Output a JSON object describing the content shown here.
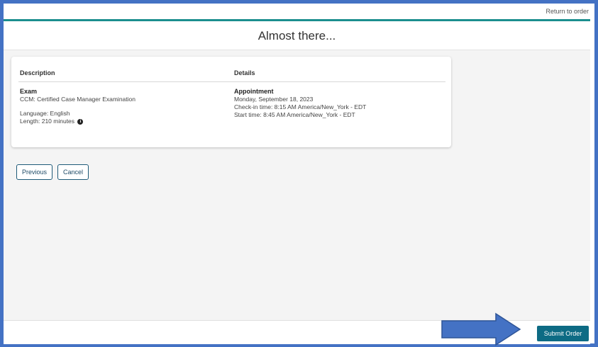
{
  "header": {
    "return_label": "Return to order"
  },
  "page": {
    "title": "Almost there..."
  },
  "summary": {
    "description_header": "Description",
    "details_header": "Details",
    "exam_label": "Exam",
    "exam_name": "CCM: Certified Case Manager Examination",
    "language": "Language: English",
    "length": "Length: 210 minutes",
    "appointment_label": "Appointment",
    "date": "Monday, September 18, 2023",
    "checkin": "Check-in time: 8:15 AM America/New_York - EDT",
    "start": "Start time: 8:45 AM America/New_York - EDT"
  },
  "actions": {
    "previous_label": "Previous",
    "cancel_label": "Cancel",
    "submit_label": "Submit Order"
  },
  "colors": {
    "frame": "#4472c4",
    "accent": "#1b8e8e",
    "submit": "#0d6b84",
    "arrow": "#4472c4"
  }
}
